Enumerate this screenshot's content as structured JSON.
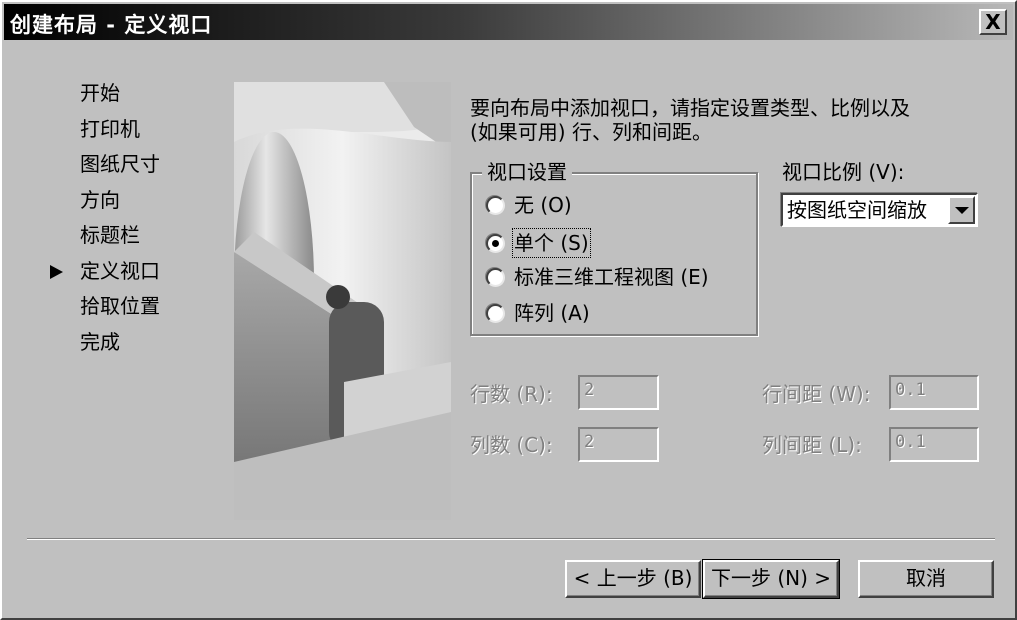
{
  "window": {
    "title": "创建布局 - 定义视口",
    "close_label": "X"
  },
  "steps": {
    "items": [
      "开始",
      "打印机",
      "图纸尺寸",
      "方向",
      "标题栏",
      "定义视口",
      "拾取位置",
      "完成"
    ],
    "current_index": 5
  },
  "intro_text_line1": "要向布局中添加视口，请指定设置类型、比例以及",
  "intro_text_line2": "(如果可用) 行、列和间距。",
  "viewport_settings": {
    "group_label": "视口设置",
    "options": [
      {
        "label": "无 (O)",
        "checked": false
      },
      {
        "label": "单个 (S)",
        "checked": true
      },
      {
        "label": "标准三维工程视图 (E)",
        "checked": false
      },
      {
        "label": "阵列 (A)",
        "checked": false
      }
    ]
  },
  "viewport_scale": {
    "label": "视口比例 (V):",
    "selected": "按图纸空间缩放"
  },
  "array": {
    "rows_label": "行数 (R):",
    "rows_value": "2",
    "cols_label": "列数 (C):",
    "cols_value": "2",
    "row_spacing_label": "行间距 (W):",
    "row_spacing_value": "0.1",
    "col_spacing_label": "列间距 (L):",
    "col_spacing_value": "0.1"
  },
  "buttons": {
    "back": "< 上一步 (B)",
    "next": "下一步 (N) >",
    "cancel": "取消"
  },
  "colors": {
    "dialog_bg": "#c0c0c0",
    "title_gradient_start": "#000000",
    "disabled_text": "#808080"
  },
  "icons": {
    "current_step": "triangle-right-icon",
    "close": "close-icon",
    "dropdown": "chevron-down-icon"
  }
}
